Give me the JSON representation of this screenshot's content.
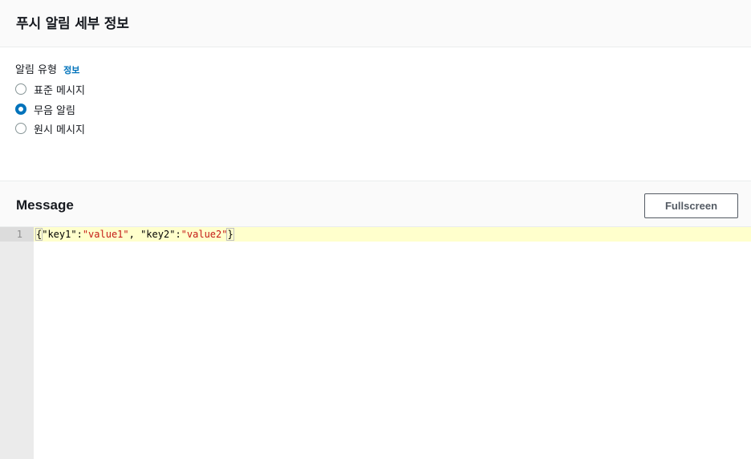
{
  "panel": {
    "title": "푸시 알림 세부 정보"
  },
  "notification_type": {
    "label": "알림 유형",
    "info_link": "정보",
    "options": [
      {
        "label": "표준 메시지",
        "selected": false
      },
      {
        "label": "무음 알림",
        "selected": true
      },
      {
        "label": "원시 메시지",
        "selected": false
      }
    ]
  },
  "editor": {
    "title": "Message",
    "fullscreen_label": "Fullscreen",
    "line_number": "1",
    "code": {
      "open_brace": "{",
      "key1": "\"key1\"",
      "colon1": ":",
      "value1": "\"value1\"",
      "sep": ", ",
      "key2": "\"key2\"",
      "colon2": ":",
      "value2": "\"value2\"",
      "close_brace": "}"
    }
  },
  "colors": {
    "accent": "#0073bb",
    "string": "#c41a16",
    "active_line": "#ffffcc"
  }
}
